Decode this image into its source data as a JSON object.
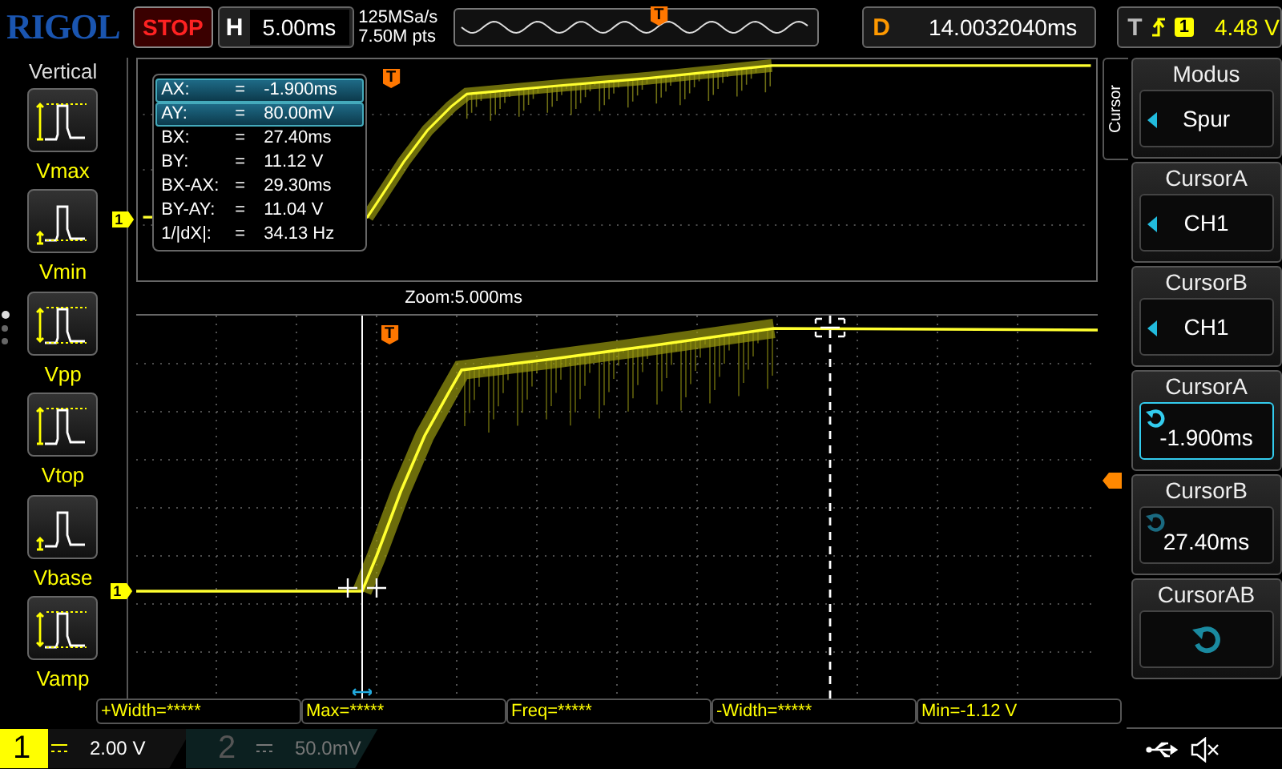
{
  "header": {
    "logo": "RIGOL",
    "run_state": "STOP",
    "horizontal": {
      "label": "H",
      "value": "5.00ms"
    },
    "sample_rate": "125MSa/s",
    "memory_depth": "7.50M pts",
    "timeline_marker": "T",
    "delay": {
      "label": "D",
      "value": "14.0032040ms"
    },
    "trigger": {
      "label": "T",
      "source": "1",
      "level": "4.48 V"
    }
  },
  "left_menu": {
    "title": "Vertical",
    "items": [
      {
        "label": "Vmax",
        "kind": "vmax"
      },
      {
        "label": "Vmin",
        "kind": "vmin"
      },
      {
        "label": "Vpp",
        "kind": "vpp"
      },
      {
        "label": "Vtop",
        "kind": "vtop"
      },
      {
        "label": "Vbase",
        "kind": "vbase"
      },
      {
        "label": "Vamp",
        "kind": "vamp"
      }
    ],
    "pages": [
      {
        "selected": true
      },
      {
        "selected": false
      },
      {
        "selected": false
      }
    ]
  },
  "cursor_readout": [
    {
      "label": "AX:",
      "sign": "=",
      "value": "-1.900ms",
      "selected": true
    },
    {
      "label": "AY:",
      "sign": "=",
      "value": "80.00mV",
      "selected": true
    },
    {
      "label": "BX:",
      "sign": "=",
      "value": "27.40ms",
      "selected": false
    },
    {
      "label": "BY:",
      "sign": "=",
      "value": "11.12 V",
      "selected": false
    },
    {
      "label": "BX-AX:",
      "sign": "=",
      "value": "29.30ms",
      "selected": false
    },
    {
      "label": "BY-AY:",
      "sign": "=",
      "value": "11.04 V",
      "selected": false
    },
    {
      "label": "1/|dX|:",
      "sign": "=",
      "value": "34.13 Hz",
      "selected": false
    }
  ],
  "main_window": {
    "channel_marker": "1",
    "trigger_marker": "T"
  },
  "zoom_window": {
    "title": "Zoom:5.000ms",
    "channel_marker": "1",
    "trigger_marker": "T"
  },
  "right_menu": {
    "tab": "Cursor",
    "items": [
      {
        "title": "Modus",
        "value": "Spur",
        "kind": "option",
        "selected": false
      },
      {
        "title": "CursorA",
        "value": "CH1",
        "kind": "option",
        "selected": false
      },
      {
        "title": "CursorB",
        "value": "CH1",
        "kind": "option",
        "selected": false
      },
      {
        "title": "CursorA",
        "value": "-1.900ms",
        "kind": "knob",
        "selected": true
      },
      {
        "title": "CursorB",
        "value": "27.40ms",
        "kind": "knob",
        "selected": false
      },
      {
        "title": "CursorAB",
        "kind": "knob-only",
        "selected": false
      }
    ]
  },
  "measurements": [
    "+Width=*****",
    "Max=*****",
    "Freq=*****",
    "-Width=*****",
    "Min=-1.12 V"
  ],
  "channels": [
    {
      "number": "1",
      "scale": "2.00 V",
      "on": true
    },
    {
      "number": "2",
      "scale": "50.0mV",
      "on": false
    }
  ]
}
